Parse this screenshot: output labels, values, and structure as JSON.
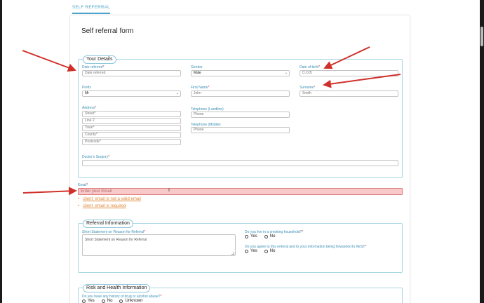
{
  "tab": {
    "label": "SELF REFERRAL"
  },
  "form": {
    "title": "Self referral form"
  },
  "your_details": {
    "legend": "Your Details",
    "date_referred": {
      "label": "Date referred",
      "placeholder": "Date referred"
    },
    "gender": {
      "label": "Gender",
      "value": "Male"
    },
    "date_of_birth": {
      "label": "Date of birth",
      "placeholder": "D.O.B"
    },
    "prefix": {
      "label": "Prefix",
      "value": "Mr"
    },
    "first_name": {
      "label": "First Name",
      "value": "John"
    },
    "surname": {
      "label": "Surname",
      "value": "Smith"
    },
    "address": {
      "label": "Address",
      "street": "Street",
      "line2": "Line 2",
      "town": "Town",
      "county": "County",
      "postcode": "Postcode"
    },
    "telephone_landline": {
      "label": "Telephone (Landline)",
      "placeholder": "Phone"
    },
    "telephone_mobile": {
      "label": "Telephone (Mobile)",
      "placeholder": "Phone"
    },
    "doctors_surgery": {
      "label": "Doctor's Surgery",
      "value": ""
    }
  },
  "email": {
    "label": "Email",
    "placeholder": "Enter your Email",
    "errors": [
      "client_email is not a valid email",
      "client_email is required"
    ]
  },
  "referral_info": {
    "legend": "Referral Information",
    "short_statement": {
      "label": "Short Statement on Reason for Referral",
      "placeholder": "Short Statement on Reason for Referral"
    },
    "smoking": {
      "label": "Do you live in a smoking household?",
      "options": [
        "Yes",
        "No"
      ]
    },
    "agree": {
      "label": "Do you agree to this referral and to your information being forwarded to NeST",
      "options": [
        "Yes",
        "No"
      ]
    }
  },
  "risk_health": {
    "legend": "Risk and Health Information",
    "drug_alcohol": {
      "label": "Do you have any history of drug or alcohol abuse?",
      "options": [
        "Yes",
        "No",
        "Unknown"
      ]
    }
  },
  "required_marker": "*",
  "colors": {
    "accent": "#4aa3c9",
    "error": "#e07b7b",
    "annotation": "#d0302a"
  }
}
